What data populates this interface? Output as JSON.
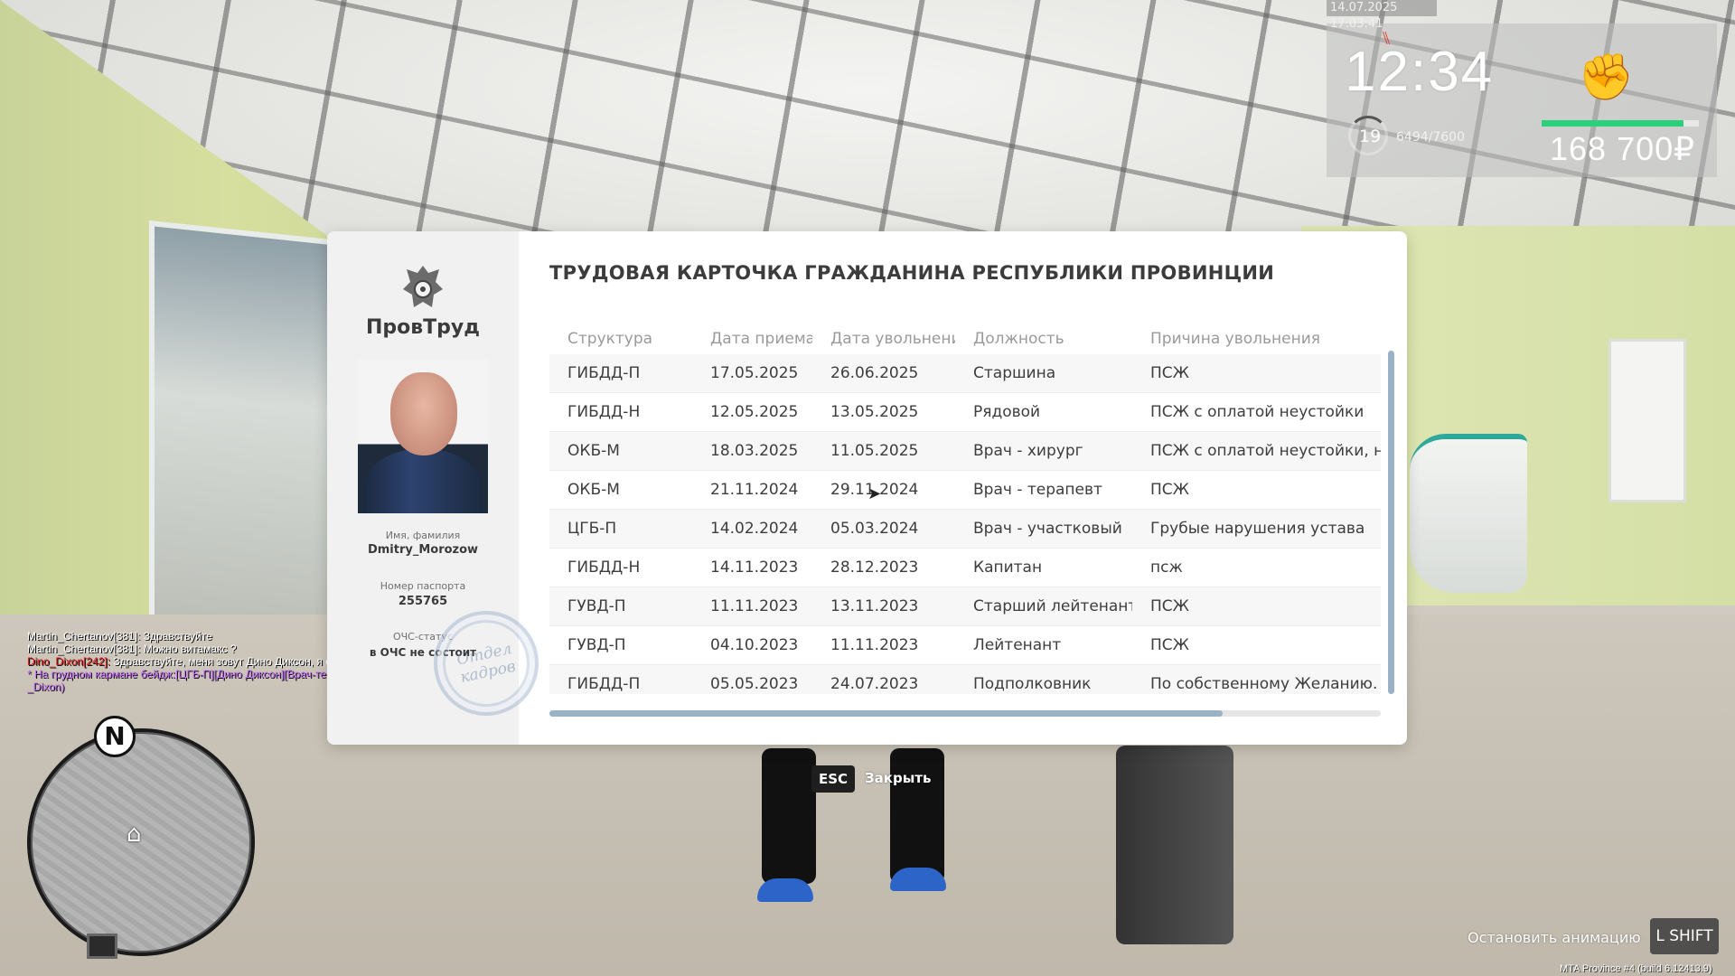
{
  "hud": {
    "datetime": "14.07.2025 17:03:41",
    "clock": "12:34",
    "level": "19",
    "exp": "6494/7600",
    "health_fraction": 0.9,
    "money": "168 700₽",
    "colors": {
      "health": "#2cd07b",
      "hunger": "#e23a2c"
    }
  },
  "chat": [
    {
      "text": "Martin_Chertanov[381]: Здравствуйте",
      "color": "#ffffff"
    },
    {
      "text": "Martin_Chertanov[381]: Можно витамакс ?",
      "color": "#ffffff"
    },
    {
      "text": "Dino_Dixon[242]: Здравствуйте, меня зовут Дино Диксон, я сотрудник ЦГБ-П.",
      "color": "#ffffff",
      "name_color": "#e21b1b"
    },
    {
      "text": "* На грудном кармане бейдж:[ЦГБ-П][Дино Диксон][Врач-терапевт|ОКНГ]. (Dino",
      "color": "#c86bff"
    },
    {
      "text": "_Dixon)",
      "color": "#c86bff"
    }
  ],
  "minimap": {
    "north_label": "N"
  },
  "card": {
    "agency": "ПровТруд",
    "title": "ТРУДОВАЯ КАРТОЧКА ГРАЖДАНИНА РЕСПУБЛИКИ ПРОВИНЦИИ",
    "name_label": "Имя, фамилия",
    "name_value": "Dmitry_Morozow",
    "passport_label": "Номер паспорта",
    "passport_value": "255765",
    "ochs_label": "ОЧС-статус",
    "ochs_value": "в ОЧС не состоит",
    "stamp_line1": "Отдел",
    "stamp_line2": "кадров",
    "columns": [
      "Структура",
      "Дата приема",
      "Дата увольнени",
      "Должность",
      "Причина увольнения"
    ],
    "rows": [
      [
        "ГИБДД-П",
        "17.05.2025",
        "26.06.2025",
        "Старшина",
        "ПСЖ"
      ],
      [
        "ГИБДД-Н",
        "12.05.2025",
        "13.05.2025",
        "Рядовой",
        "ПСЖ с оплатой неустойки"
      ],
      [
        "ОКБ-М",
        "18.03.2025",
        "11.05.2025",
        "Врач - хирург",
        "ПСЖ с оплатой неустойки, н"
      ],
      [
        "ОКБ-М",
        "21.11.2024",
        "29.11.2024",
        "Врач - терапевт",
        "ПСЖ"
      ],
      [
        "ЦГБ-П",
        "14.02.2024",
        "05.03.2024",
        "Врач - участковый",
        "Грубые нарушения устава"
      ],
      [
        "ГИБДД-Н",
        "14.11.2023",
        "28.12.2023",
        "Капитан",
        "псж"
      ],
      [
        "ГУВД-П",
        "11.11.2023",
        "13.11.2023",
        "Старший лейтенант",
        "ПСЖ"
      ],
      [
        "ГУВД-П",
        "04.10.2023",
        "11.11.2023",
        "Лейтенант",
        "ПСЖ"
      ],
      [
        "ГИБДД-П",
        "05.05.2023",
        "24.07.2023",
        "Подполковник",
        "По собственному Желанию."
      ]
    ],
    "hscroll_fraction": 0.81,
    "vscroll_fraction": 1.0
  },
  "close": {
    "key": "ESC",
    "label": "Закрыть"
  },
  "animation": {
    "label": "Остановить анимацию",
    "key": "L SHIFT"
  },
  "build": "MTA Province #4 (build 6.12413.9)"
}
